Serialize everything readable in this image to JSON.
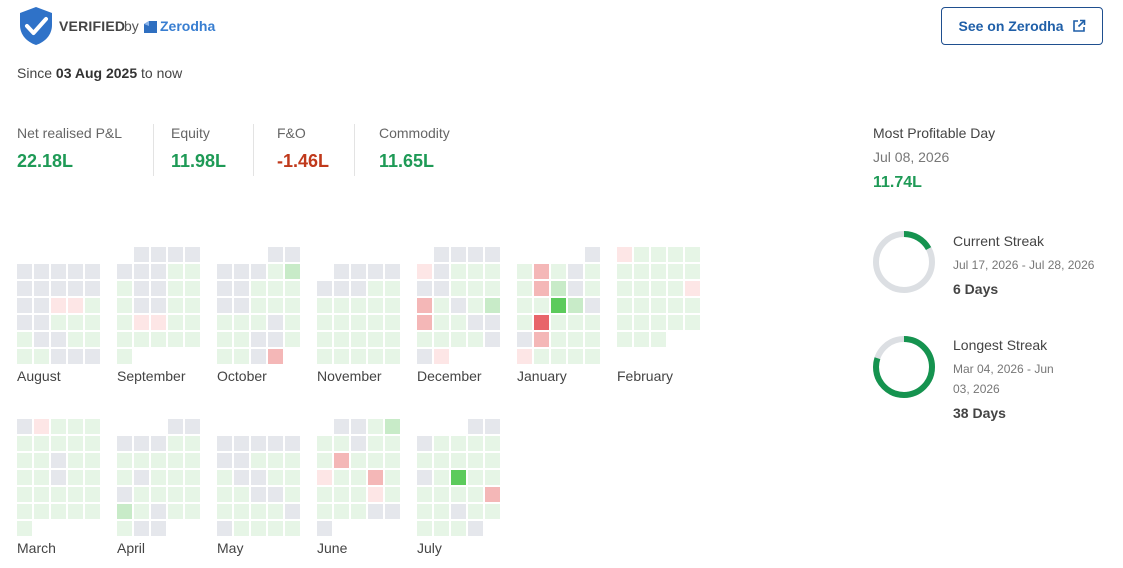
{
  "header": {
    "verified_label": "VERIFIED",
    "by_label": "by",
    "broker_name": "Zerodha",
    "see_button_label": "See on Zerodha"
  },
  "since": {
    "prefix": "Since",
    "date": "03 Aug 2025",
    "suffix": "to now"
  },
  "stats": [
    {
      "label": "Net realised P&L",
      "value": "22.18L",
      "tone": "green"
    },
    {
      "label": "Equity",
      "value": "11.98L",
      "tone": "green"
    },
    {
      "label": "F&O",
      "value": "-1.46L",
      "tone": "red"
    },
    {
      "label": "Commodity",
      "value": "11.65L",
      "tone": "green"
    }
  ],
  "most_profitable": {
    "label": "Most Profitable Day",
    "date": "Jul 08, 2026",
    "value": "11.74L"
  },
  "current_streak": {
    "title": "Current Streak",
    "range": "Jul 17, 2026 - Jul 28, 2026",
    "days": "6 Days",
    "fill": 0.17
  },
  "longest_streak": {
    "title": "Longest Streak",
    "range": "Mar 04, 2026 - Jun 03, 2026",
    "days": "38 Days",
    "fill": 0.8
  },
  "colors": {
    "green": "#1e9a56",
    "red": "#c0391b",
    "blue": "#387ed1",
    "cell_empty": "#e5e7ec",
    "cell_g1": "#e6f5e6",
    "cell_g2": "#c8ebc8",
    "cell_g3": "#5ccb5c",
    "cell_r1": "#fde6e6",
    "cell_r2": "#f4b7b7",
    "cell_r3": "#e8656a",
    "ring_track": "#dcdfe3",
    "ring_fill": "#15934f"
  },
  "months": [
    {
      "name": "August",
      "offset": 5,
      "days": 31,
      "codes": "eeeeeeeeeeeerrgeeggggeeggggeeegggeeeggRgeeggggeeeeeee"
    },
    {
      "name": "September",
      "offset": 1,
      "days": 30,
      "codes": "eeeeeeegggeegggeegggrrggggggggggegggeeg"
    },
    {
      "name": "October",
      "offset": 3,
      "days": 31,
      "codes": "eeeeegGeegggeeggggggegggeegggeRggegrgee"
    },
    {
      "name": "November",
      "offset": 6,
      "days": 30,
      "codes": "eeeeeeegggggggggggggggggggggggggggegggggeee"
    },
    {
      "name": "December",
      "offset": 1,
      "days": 31,
      "codes": "eeeeregggeegggRgegGRggeeggggeerggeee"
    },
    {
      "name": "January",
      "offset": 4,
      "days": 31,
      "codes": "egRgeggRGegggXGegggggeRgggrggggeggg"
    },
    {
      "name": "February",
      "offset": 0,
      "days": 28,
      "codes": "rgggggggggggggrggggggggggggg"
    },
    {
      "name": "March",
      "offset": 0,
      "days": 31,
      "codes": "erggggggggggeggggegggggggggggggee"
    },
    {
      "name": "April",
      "offset": 3,
      "days": 30,
      "codes": "eeeeeggggggggegggeggggGgegggeeggg"
    },
    {
      "name": "May",
      "offset": 5,
      "days": 31,
      "codes": "eeeeeeeggggeeggggeegggggeeggggeeeeeee"
    },
    {
      "name": "June",
      "offset": 1,
      "days": 30,
      "codes": "eegGggegggRgggrggRggggrggggeeeeeee"
    },
    {
      "name": "July",
      "offset": 3,
      "days": 31,
      "codes": "eeegggggggggegXggggggRggegggggeeeegee"
    }
  ]
}
